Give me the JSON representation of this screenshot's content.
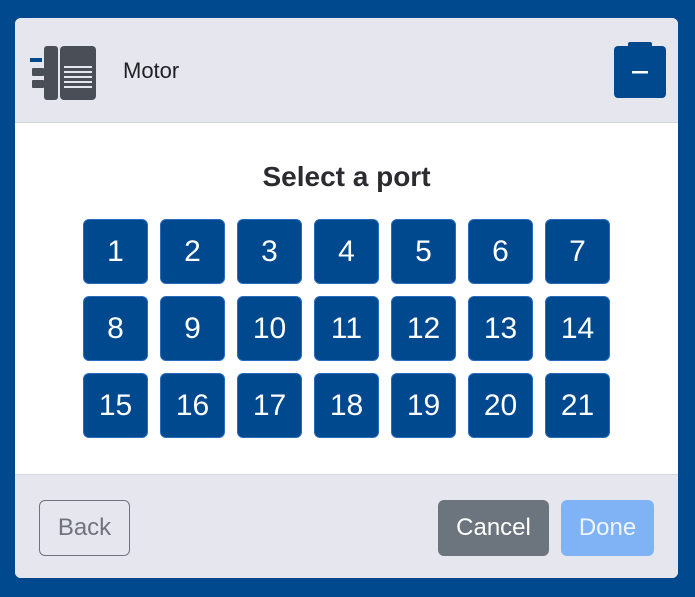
{
  "header": {
    "title": "Motor",
    "icon": "motor-icon",
    "collapse_icon": "minus-icon"
  },
  "body": {
    "prompt": "Select a port",
    "ports": [
      "1",
      "2",
      "3",
      "4",
      "5",
      "6",
      "7",
      "8",
      "9",
      "10",
      "11",
      "12",
      "13",
      "14",
      "15",
      "16",
      "17",
      "18",
      "19",
      "20",
      "21"
    ]
  },
  "footer": {
    "back_label": "Back",
    "cancel_label": "Cancel",
    "done_label": "Done"
  },
  "colors": {
    "background": "#00498f",
    "port_button": "#00498f",
    "cancel_button": "#6c757d",
    "done_button_disabled": "#80b3f6",
    "header_footer": "#e6e7ee"
  }
}
